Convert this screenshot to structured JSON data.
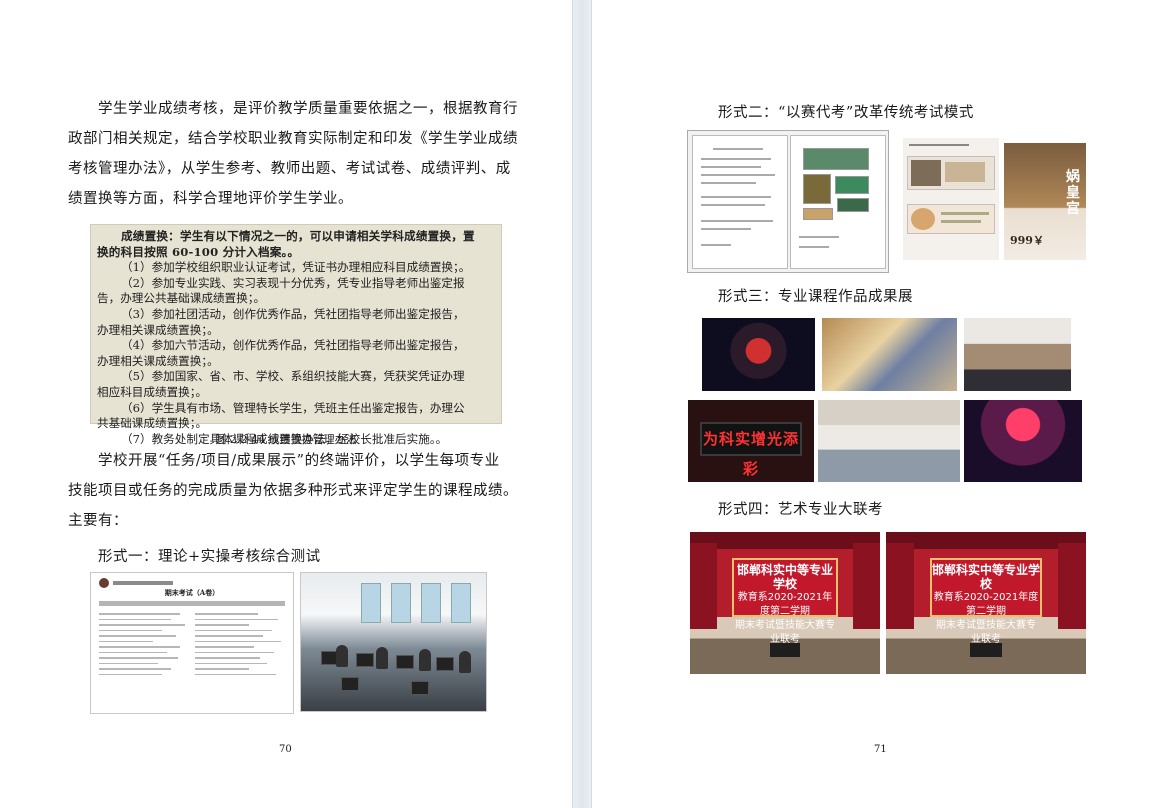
{
  "left_page": {
    "paragraph1": [
      "学生学业成绩考核，是评价教学质量重要依据之一，根据教育行",
      "政部门相关规定，结合学校职业教育实际制定和印发《学生学业成绩",
      "考核管理办法》，从学生参考、教师出题、考试试卷、成绩评判、成",
      "绩置换等方面，科学合理地评价学生学业。"
    ],
    "scan": {
      "header": [
        "成绩置换：学生有以下情况之一的，可以申请相关学科成绩置换，置",
        "换的科目按照 60-100 分计入档案。。"
      ],
      "items": [
        [
          "（1）参加学校组织职业认证考试，凭证书办理相应科目成绩置换；。"
        ],
        [
          "（2）参加专业实践、实习表现十分优秀，凭专业指导老师出鉴定报",
          "告，办理公共基础课成绩置换；。"
        ],
        [
          "（3）参加社团活动，创作优秀作品，凭社团指导老师出鉴定报告，",
          "办理相关课成绩置换；。"
        ],
        [
          "（4）参加六节活动，创作优秀作品，凭社团指导老师出鉴定报告，",
          "办理相关课成绩置换；。"
        ],
        [
          "（5）参加国家、省、市、学校、系组织技能大赛，凭获奖凭证办理",
          "相应科目成绩置换；。"
        ],
        [
          "（6）学生具有市场、管理特长学生，凭班主任出鉴定报告，办理公",
          "共基础课成绩置换；。"
        ],
        [
          "（7）教务处制定具体课程成绩置换办法，经校长批准后实施。。"
        ]
      ]
    },
    "caption": "图 2.2-44 成绩置换管理办法",
    "paragraph2": [
      "学校开展“任务/项目/成果展示”的终端评价，以学生每项专业",
      "技能项目或任务的完成质量为依据多种形式来评定学生的课程成绩。",
      "主要有："
    ],
    "form1": "形式一：理论+实操考核综合测试",
    "exam_title": "期末考试（A卷）",
    "page_number": "70"
  },
  "right_page": {
    "form2": "形式二：“以赛代考”改革传统考试模式",
    "poster": {
      "title": "娲皇宫",
      "price": "999￥"
    },
    "form3": "形式三：专业课程作品成果展",
    "led_text": "为科实增光添彩",
    "form4": "形式四：艺术专业大联考",
    "stage_banner": {
      "school": "邯郸科实中等专业学校",
      "event": "教育系2020-2021年度第二学期",
      "event2": "期末考试暨技能大赛专业联考"
    },
    "page_number": "71"
  }
}
